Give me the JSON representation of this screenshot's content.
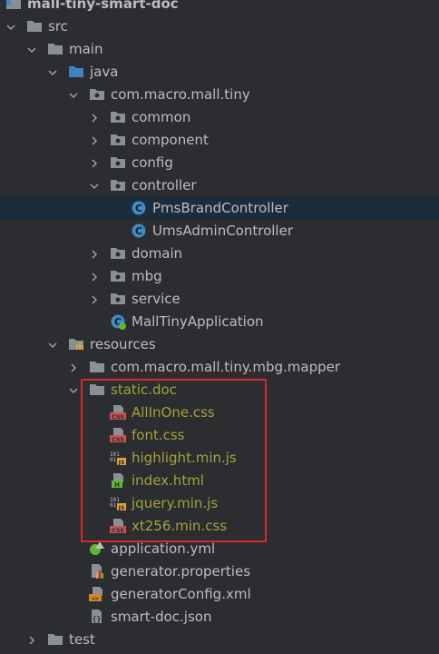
{
  "tree": {
    "items": [
      {
        "label": "mall-tiny-smart-doc",
        "icon": "module-folder",
        "expanded": true,
        "changed": false,
        "selected": false
      },
      {
        "label": "src",
        "icon": "folder",
        "expanded": true,
        "changed": false,
        "selected": false
      },
      {
        "label": "main",
        "icon": "folder",
        "expanded": true,
        "changed": false,
        "selected": false
      },
      {
        "label": "java",
        "icon": "source-folder",
        "expanded": true,
        "changed": false,
        "selected": false
      },
      {
        "label": "com.macro.mall.tiny",
        "icon": "package",
        "expanded": true,
        "changed": false,
        "selected": false
      },
      {
        "label": "common",
        "icon": "package",
        "expanded": false,
        "changed": false,
        "selected": false
      },
      {
        "label": "component",
        "icon": "package",
        "expanded": false,
        "changed": false,
        "selected": false
      },
      {
        "label": "config",
        "icon": "package",
        "expanded": false,
        "changed": false,
        "selected": false
      },
      {
        "label": "controller",
        "icon": "package",
        "expanded": true,
        "changed": false,
        "selected": false
      },
      {
        "label": "PmsBrandController",
        "icon": "java-class",
        "expanded": null,
        "changed": false,
        "selected": true
      },
      {
        "label": "UmsAdminController",
        "icon": "java-class",
        "expanded": null,
        "changed": false,
        "selected": false
      },
      {
        "label": "domain",
        "icon": "package",
        "expanded": false,
        "changed": false,
        "selected": false
      },
      {
        "label": "mbg",
        "icon": "package",
        "expanded": false,
        "changed": false,
        "selected": false
      },
      {
        "label": "service",
        "icon": "package",
        "expanded": false,
        "changed": false,
        "selected": false
      },
      {
        "label": "MallTinyApplication",
        "icon": "spring-boot-class",
        "expanded": null,
        "changed": false,
        "selected": false
      },
      {
        "label": "resources",
        "icon": "resources-folder",
        "expanded": true,
        "changed": false,
        "selected": false
      },
      {
        "label": "com.macro.mall.tiny.mbg.mapper",
        "icon": "folder",
        "expanded": false,
        "changed": false,
        "selected": false
      },
      {
        "label": "static.doc",
        "icon": "folder",
        "expanded": true,
        "changed": true,
        "selected": false
      },
      {
        "label": "AllInOne.css",
        "icon": "css-file",
        "expanded": null,
        "changed": true,
        "selected": false
      },
      {
        "label": "font.css",
        "icon": "css-file",
        "expanded": null,
        "changed": true,
        "selected": false
      },
      {
        "label": "highlight.min.js",
        "icon": "js-file",
        "expanded": null,
        "changed": true,
        "selected": false
      },
      {
        "label": "index.html",
        "icon": "html-file",
        "expanded": null,
        "changed": true,
        "selected": false
      },
      {
        "label": "jquery.min.js",
        "icon": "js-file",
        "expanded": null,
        "changed": true,
        "selected": false
      },
      {
        "label": "xt256.min.css",
        "icon": "css-file",
        "expanded": null,
        "changed": true,
        "selected": false
      },
      {
        "label": "application.yml",
        "icon": "yaml-file",
        "expanded": null,
        "changed": false,
        "selected": false
      },
      {
        "label": "generator.properties",
        "icon": "properties-file",
        "expanded": null,
        "changed": false,
        "selected": false
      },
      {
        "label": "generatorConfig.xml",
        "icon": "xml-file",
        "expanded": null,
        "changed": false,
        "selected": false
      },
      {
        "label": "smart-doc.json",
        "icon": "json-file",
        "expanded": null,
        "changed": false,
        "selected": false
      },
      {
        "label": "test",
        "icon": "folder",
        "expanded": false,
        "changed": false,
        "selected": false
      }
    ]
  },
  "colors": {
    "background": "#2b2d30",
    "selected_row": "#1d2c3b",
    "text": "#bbbdc2",
    "changed_text": "#a7a23a",
    "highlight_box": "#d6282d"
  }
}
